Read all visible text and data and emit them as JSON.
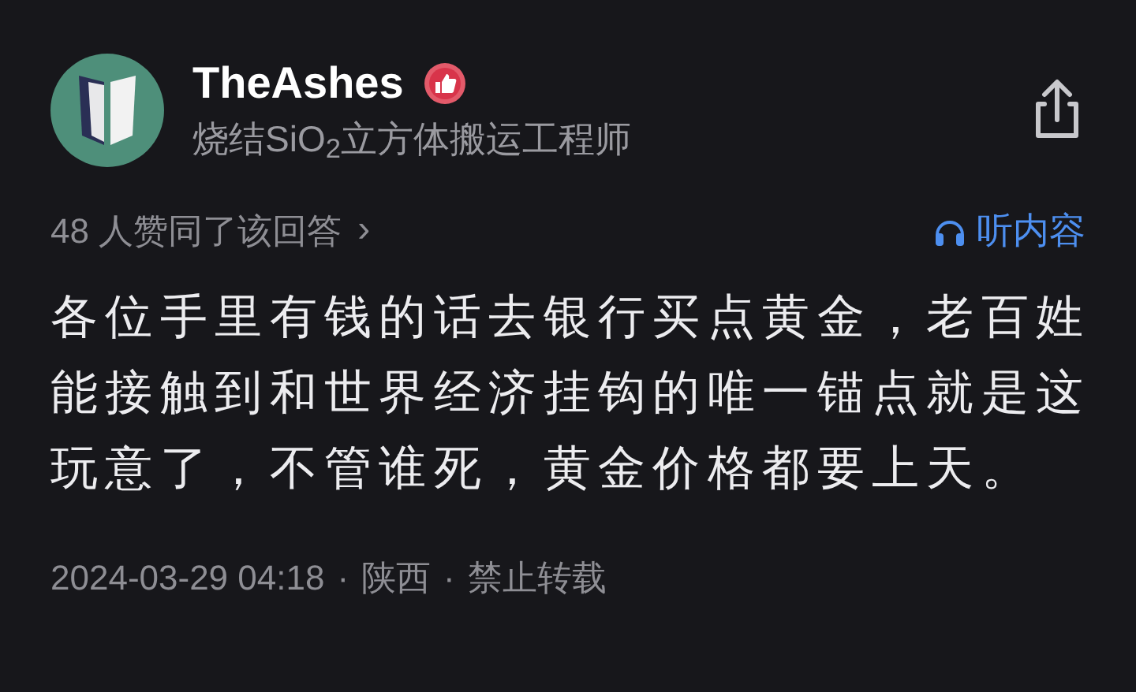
{
  "author": {
    "name": "TheAshes",
    "bio": "烧结SiO$_{2}$立方体搬运工程师"
  },
  "upvote_summary": {
    "text": "48 人赞同了该回答",
    "chevron": "›"
  },
  "listen_button": {
    "label": "听内容"
  },
  "answer": {
    "text": "各位手里有钱的话去银行买点黄金，老百姓能接触到和世界经济挂钩的唯一锚点就是这玩意了，不管谁死，黄金价格都要上天。"
  },
  "meta": {
    "time": "2024-03-29 04:18",
    "separator_1": "·",
    "location": "陕西",
    "separator_2": "·",
    "copyright": "禁止转载"
  }
}
